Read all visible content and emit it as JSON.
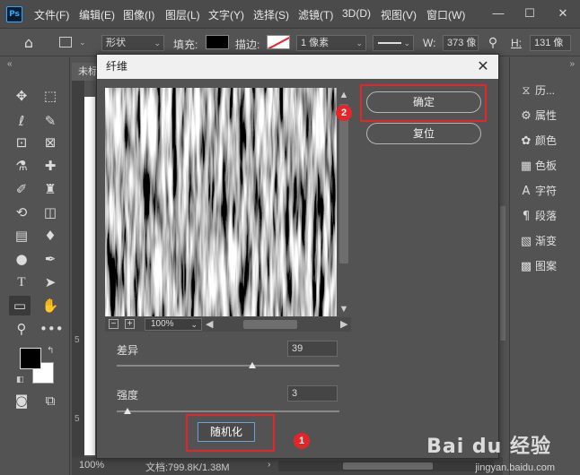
{
  "app": {
    "logo": "Ps"
  },
  "menu": [
    "文件(F)",
    "编辑(E)",
    "图像(I)",
    "图层(L)",
    "文字(Y)",
    "选择(S)",
    "滤镜(T)",
    "3D(D)",
    "视图(V)",
    "窗口(W)"
  ],
  "window_controls": {
    "minimize": "—",
    "maximize": "☐",
    "close": "✕"
  },
  "options_bar": {
    "mode": "形状",
    "fill_label": "填充:",
    "stroke_label": "描边:",
    "stroke_width": "1 像素",
    "w_label": "W:",
    "w_value": "373 像",
    "h_label": "H:",
    "h_value": "131 像"
  },
  "document": {
    "tab_title": "未标",
    "ruler_marks": [
      "5",
      "5"
    ],
    "zoom": "100%",
    "doc_info": "文档:799.8K/1.38M"
  },
  "right_panel": [
    {
      "label": "历...",
      "icon": "history-icon"
    },
    {
      "label": "属性",
      "icon": "properties-icon"
    },
    {
      "label": "颜色",
      "icon": "color-icon"
    },
    {
      "label": "色板",
      "icon": "swatches-icon"
    },
    {
      "label": "字符",
      "icon": "character-icon"
    },
    {
      "label": "段落",
      "icon": "paragraph-icon"
    },
    {
      "label": "渐变",
      "icon": "gradient-icon"
    },
    {
      "label": "图案",
      "icon": "patterns-icon"
    }
  ],
  "dialog": {
    "title": "纤维",
    "ok_label": "确定",
    "reset_label": "复位",
    "preview_zoom": "100%",
    "variance_label": "差异",
    "variance_value": "39",
    "variance_max": 64,
    "strength_label": "强度",
    "strength_value": "3",
    "strength_max": 64,
    "randomize_label": "随机化"
  },
  "annotations": {
    "badge_1": "1",
    "badge_2": "2",
    "color": "#e5252a"
  },
  "watermark": {
    "main": "Bai du 经验",
    "sub": "jingyan.baidu.com"
  }
}
